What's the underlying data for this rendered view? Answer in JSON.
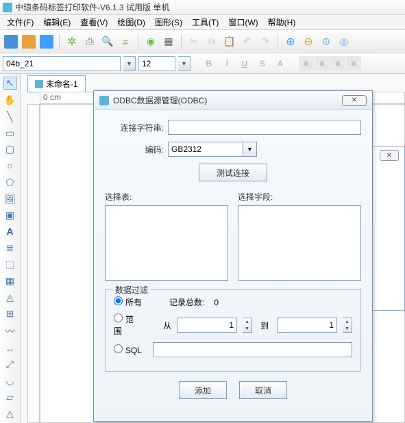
{
  "app": {
    "title": "中琅条码标签打印软件-V6.1.3 试用版 单机"
  },
  "menu": {
    "file": "文件(F)",
    "edit": "编辑(E)",
    "view": "查看(V)",
    "draw": "绘图(D)",
    "shape": "图形(S)",
    "tool": "工具(T)",
    "window": "窗口(W)",
    "help": "帮助(H)"
  },
  "format": {
    "font": "04b_21",
    "size": "12"
  },
  "doc": {
    "tab_name": "未命名-1"
  },
  "ruler": {
    "origin": "0 cm"
  },
  "dialog": {
    "title": "ODBC数据源管理(ODBC)",
    "conn_label": "连接字符串:",
    "conn_value": "",
    "encoding_label": "编码:",
    "encoding_value": "GB2312",
    "test_btn": "测试连接",
    "select_table": "选择表:",
    "select_field": "选择字段:",
    "filter_legend": "数据过滤",
    "radio_all": "所有",
    "record_count_label": "记录总数:",
    "record_count": "0",
    "radio_range": "范围",
    "from_label": "从",
    "from_value": "1",
    "to_label": "到",
    "to_value": "1",
    "radio_sql": "SQL",
    "sql_value": "",
    "add_btn": "添加",
    "cancel_btn": "取消"
  }
}
